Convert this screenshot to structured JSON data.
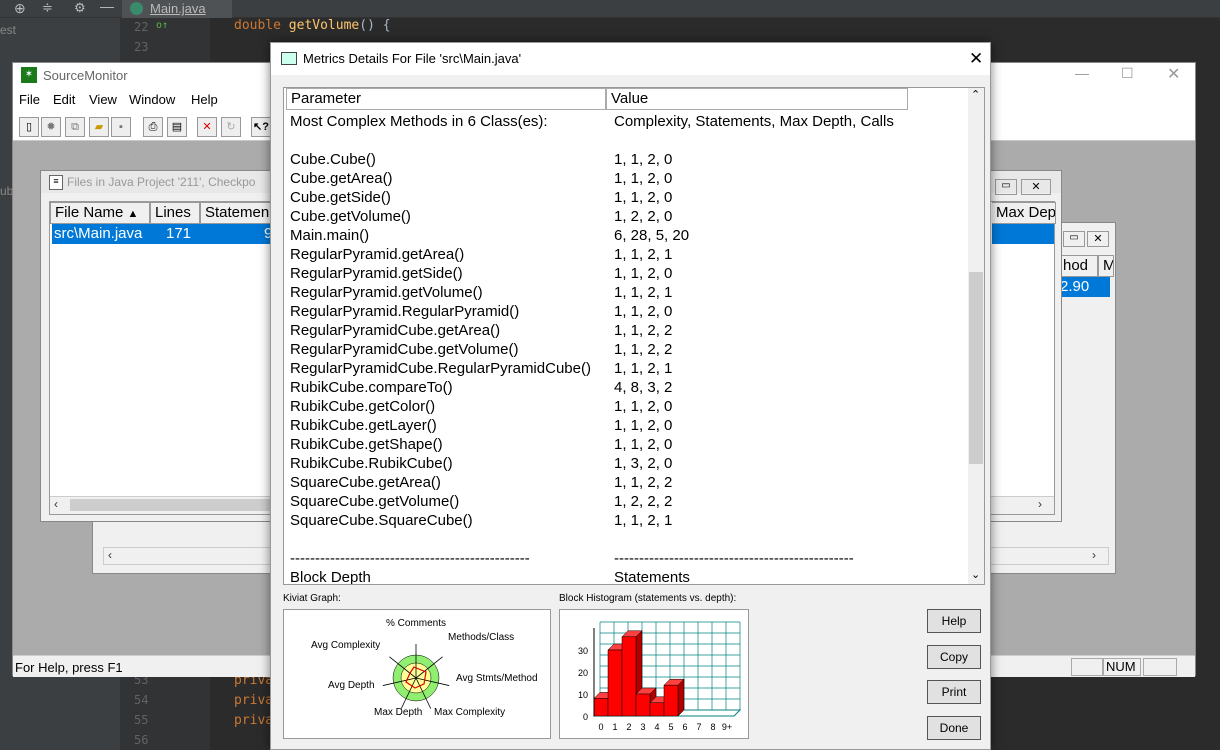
{
  "ide": {
    "tab_label": "Main.java",
    "left_text_1": "est",
    "left_text_2": "ub",
    "gutter_top": [
      "22",
      "23"
    ],
    "gutter_bottom": [
      "53",
      "54",
      "55",
      "56"
    ],
    "code_line_22": [
      "double ",
      "getVolume",
      "() {"
    ],
    "code_bottom": [
      "priva",
      "priva",
      "priva"
    ]
  },
  "app": {
    "title": "SourceMonitor",
    "menu": [
      "File",
      "Edit",
      "View",
      "Window",
      "Help"
    ],
    "status": "For Help, press F1",
    "num_indicator": "NUM"
  },
  "files_window": {
    "title": "Files in Java Project '211', Checkpo",
    "columns": [
      "File Name",
      "Lines",
      "Statemen"
    ],
    "sort_indicator": "▲",
    "row": {
      "file": "src\\Main.java",
      "lines": "171",
      "statements": "9"
    },
    "right_column": "Max Dep"
  },
  "back_window": {
    "col_a": "hod",
    "col_b": "M",
    "value": "2.90"
  },
  "dialog": {
    "title": "Metrics Details For File 'src\\Main.java'",
    "col_param": "Parameter",
    "col_value": "Value",
    "rows": [
      {
        "p": "Most Complex Methods in 6 Class(es):",
        "v": "Complexity, Statements, Max Depth, Calls"
      },
      {
        "p": "",
        "v": ""
      },
      {
        "p": "Cube.Cube()",
        "v": "1, 1, 2, 0"
      },
      {
        "p": "Cube.getArea()",
        "v": "1, 1, 2, 0"
      },
      {
        "p": "Cube.getSide()",
        "v": "1, 1, 2, 0"
      },
      {
        "p": "Cube.getVolume()",
        "v": "1, 2, 2, 0"
      },
      {
        "p": "Main.main()",
        "v": "6, 28, 5, 20"
      },
      {
        "p": "RegularPyramid.getArea()",
        "v": "1, 1, 2, 1"
      },
      {
        "p": "RegularPyramid.getSide()",
        "v": "1, 1, 2, 0"
      },
      {
        "p": "RegularPyramid.getVolume()",
        "v": "1, 1, 2, 1"
      },
      {
        "p": "RegularPyramid.RegularPyramid()",
        "v": "1, 1, 2, 0"
      },
      {
        "p": "RegularPyramidCube.getArea()",
        "v": "1, 1, 2, 2"
      },
      {
        "p": "RegularPyramidCube.getVolume()",
        "v": "1, 1, 2, 2"
      },
      {
        "p": "RegularPyramidCube.RegularPyramidCube()",
        "v": "1, 1, 2, 1"
      },
      {
        "p": "RubikCube.compareTo()",
        "v": "4, 8, 3, 2"
      },
      {
        "p": "RubikCube.getColor()",
        "v": "1, 1, 2, 0"
      },
      {
        "p": "RubikCube.getLayer()",
        "v": "1, 1, 2, 0"
      },
      {
        "p": "RubikCube.getShape()",
        "v": "1, 1, 2, 0"
      },
      {
        "p": "RubikCube.RubikCube()",
        "v": "1, 3, 2, 0"
      },
      {
        "p": "SquareCube.getArea()",
        "v": "1, 1, 2, 2"
      },
      {
        "p": "SquareCube.getVolume()",
        "v": "1, 2, 2, 2"
      },
      {
        "p": "SquareCube.SquareCube()",
        "v": "1, 1, 2, 1"
      },
      {
        "p": "",
        "v": ""
      },
      {
        "p": "------------------------------------------------",
        "v": "------------------------------------------------"
      },
      {
        "p": "Block Depth",
        "v": "Statements"
      }
    ],
    "kiviat_label": "Kiviat Graph:",
    "kiviat_axes": [
      "% Comments",
      "Methods/Class",
      "Avg Stmts/Method",
      "Max Complexity",
      "Max Depth",
      "Avg Depth",
      "Avg Complexity"
    ],
    "histogram_label": "Block Histogram (statements vs. depth):",
    "buttons": {
      "help": "Help",
      "copy": "Copy",
      "print": "Print",
      "done": "Done"
    }
  },
  "chart_data": {
    "type": "bar",
    "title": "Block Histogram (statements vs. depth):",
    "categories": [
      "0",
      "1",
      "2",
      "3",
      "4",
      "5",
      "6",
      "7",
      "8",
      "9+"
    ],
    "values": [
      8,
      30,
      36,
      10,
      6,
      14,
      0,
      0,
      0,
      0
    ],
    "yticks": [
      "0",
      "10",
      "20",
      "30"
    ],
    "ylim": [
      0,
      40
    ],
    "bar_color": "#ff0000",
    "grid": true
  }
}
